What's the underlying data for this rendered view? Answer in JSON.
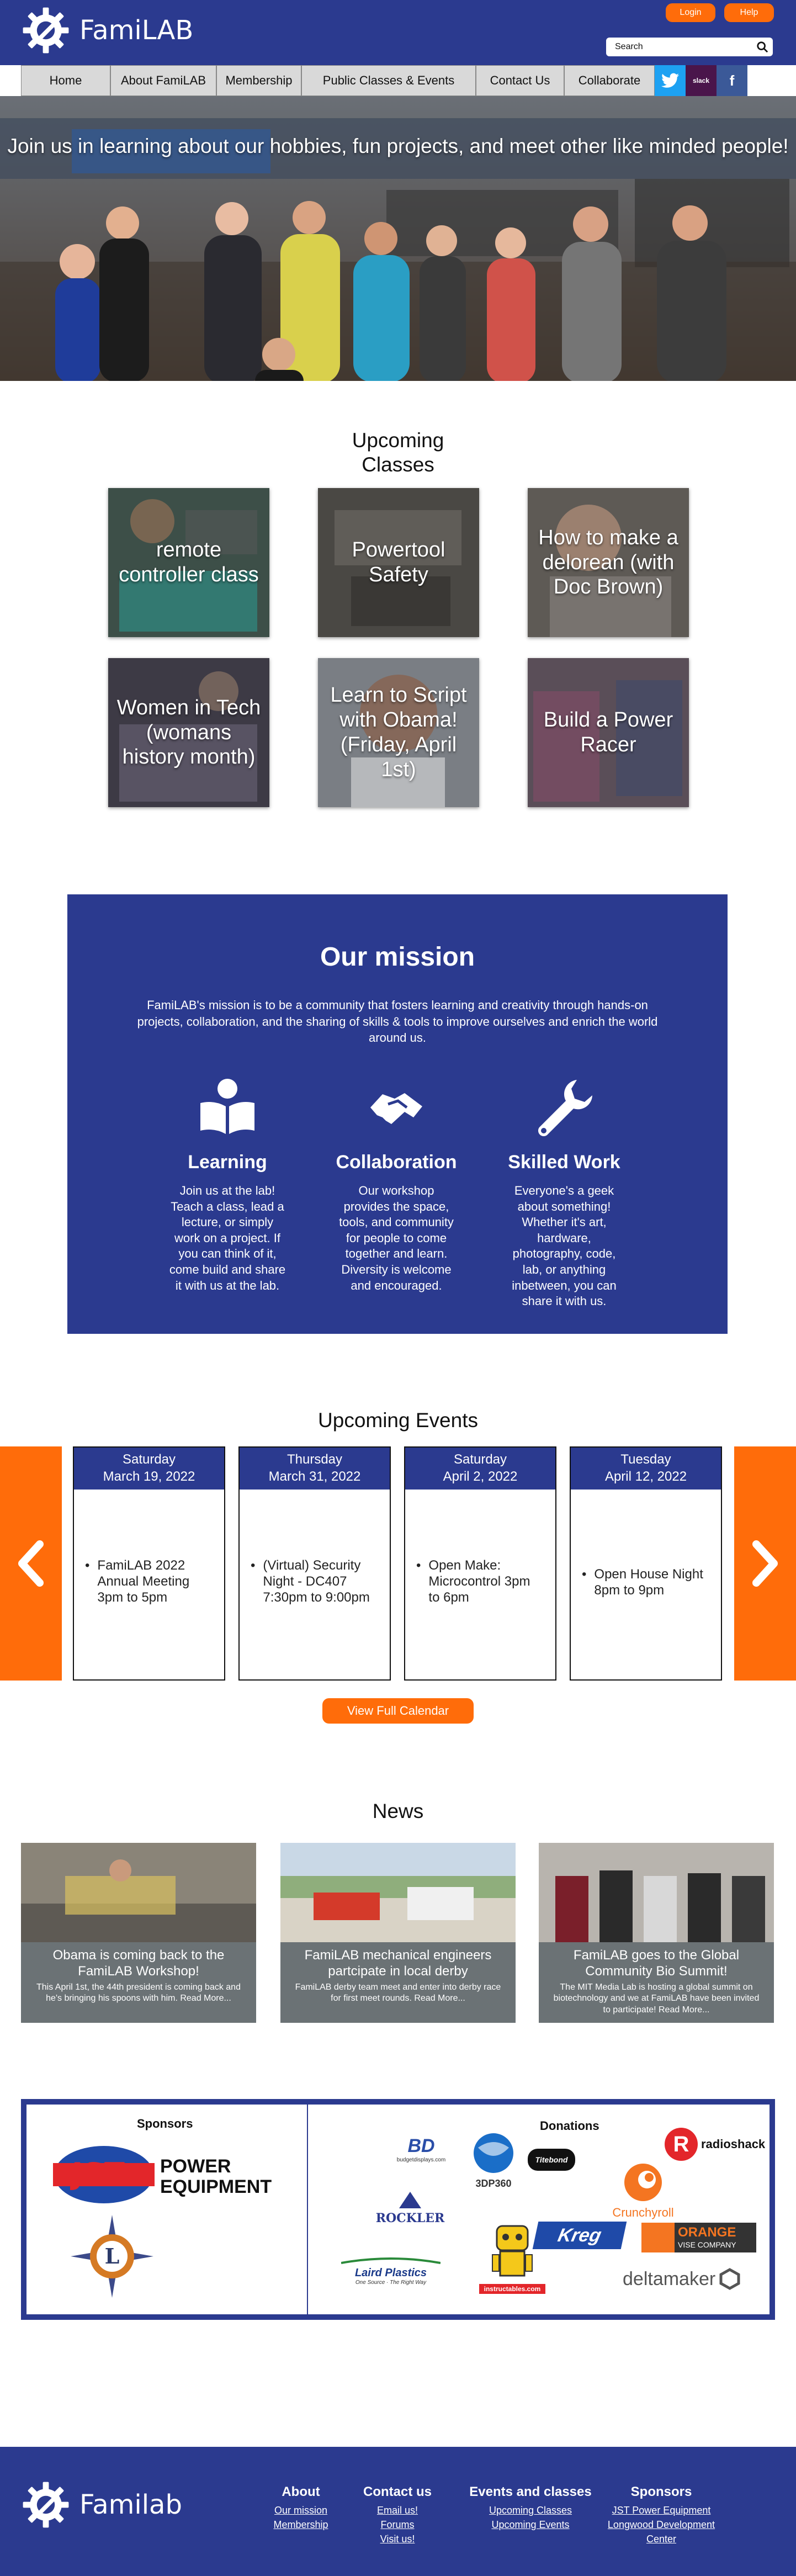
{
  "header": {
    "brand": "FamiLAB",
    "login": "Login",
    "help": "Help",
    "search_placeholder": "Search"
  },
  "nav": {
    "items": [
      "Home",
      "About FamiLAB",
      "Membership",
      "Public Classes & Events",
      "Contact Us",
      "Collaborate"
    ],
    "slack_label": "slack",
    "facebook_label": "f"
  },
  "hero": {
    "caption": "Join us in learning about our hobbies, fun projects, and meet other like minded people!"
  },
  "classes": {
    "title_line1": "Upcoming",
    "title_line2": "Classes",
    "items": [
      "remote controller class",
      "Powertool Safety",
      "How to make a delorean (with Doc Brown)",
      "Women in Tech (womans history month)",
      "Learn to Script with Obama! (Friday, April 1st)",
      "Build a Power Racer"
    ]
  },
  "mission": {
    "title": "Our mission",
    "description": "FamiLAB's mission is to be a community that fosters learning and creativity through hands-on projects, collaboration, and the sharing of skills & tools to improve ourselves and enrich the world around us.",
    "pillars": [
      {
        "title": "Learning",
        "text": "Join us at the lab! Teach a class, lead a lecture, or simply work on a project. If you can think of it, come build and share it with us at the lab."
      },
      {
        "title": "Collaboration",
        "text": "Our workshop provides the space, tools, and community for people to come together and learn. Diversity is welcome and encouraged."
      },
      {
        "title": "Skilled Work",
        "text": "Everyone's a geek about something! Whether it's art, hardware, photography, code, lab, or anything inbetween, you can share it with us."
      }
    ]
  },
  "events": {
    "title": "Upcoming Events",
    "items": [
      {
        "day": "Saturday",
        "date": "March 19, 2022",
        "desc": "FamiLAB 2022 Annual Meeting 3pm to 5pm"
      },
      {
        "day": "Thursday",
        "date": "March 31, 2022",
        "desc": "(Virtual) Security Night - DC407 7:30pm to 9:00pm"
      },
      {
        "day": "Saturday",
        "date": "April 2, 2022",
        "desc": "Open Make: Microcontrol 3pm to 6pm"
      },
      {
        "day": "Tuesday",
        "date": "April 12, 2022",
        "desc": "Open House Night 8pm to 9pm"
      }
    ],
    "bullet": "•",
    "calendar_button": "View Full Calendar"
  },
  "news": {
    "title": "News",
    "items": [
      {
        "title": "Obama is coming back to the FamiLAB Workshop!",
        "desc": "This April 1st, the 44th president is coming back and he's bringing his spoons with him. Read More..."
      },
      {
        "title": "FamiLAB mechanical engineers partcipate in local derby",
        "desc": "FamiLAB derby team meet and enter into derby race for first meet rounds. Read More..."
      },
      {
        "title": "FamiLAB goes to the Global Community Bio Summit!",
        "desc": "The MIT Media Lab is hosting a global summit on biotechnology and we at FamiLAB have been invited to participate! Read More..."
      }
    ]
  },
  "sponsors": {
    "sponsors_title": "Sponsors",
    "donations_title": "Donations",
    "jst_mark": "JST",
    "jst_name_line1": "POWER",
    "jst_name_line2": "EQUIPMENT",
    "donors": {
      "bd": "BD",
      "bd_sub": "budgetdisplays.com",
      "sdp": "3DP360",
      "timbbond": "Titebond",
      "radioshack": "radioshack",
      "radioshack_mark": "R",
      "rockler": "ROCKLER",
      "crunchyroll": "Crunchyroll",
      "orange_line1": "ORANGE",
      "orange_line2": "VISE COMPANY",
      "laird": "Laird Plastics",
      "laird_tag": "One Source · The Right Way",
      "instructables": "instructables.com",
      "kreg": "Kreg",
      "deltamaker": "deltamaker"
    }
  },
  "footer": {
    "brand": "Familab",
    "columns": [
      {
        "title": "About",
        "links": [
          "Our mission",
          "Membership"
        ]
      },
      {
        "title": "Contact us",
        "links": [
          "Email us!",
          "Forums",
          "Visit us!"
        ]
      },
      {
        "title": "Events and classes",
        "links": [
          "Upcoming Classes",
          "Upcoming Events"
        ]
      },
      {
        "title": "Sponsors",
        "links": [
          "JST Power Equipment",
          "Longwood Development Center"
        ]
      }
    ]
  },
  "colors": {
    "brand_blue": "#2b3a8f",
    "accent_orange": "#ff6c0a",
    "nav_gray": "#d9d9d9",
    "news_gray": "#6b7275"
  }
}
